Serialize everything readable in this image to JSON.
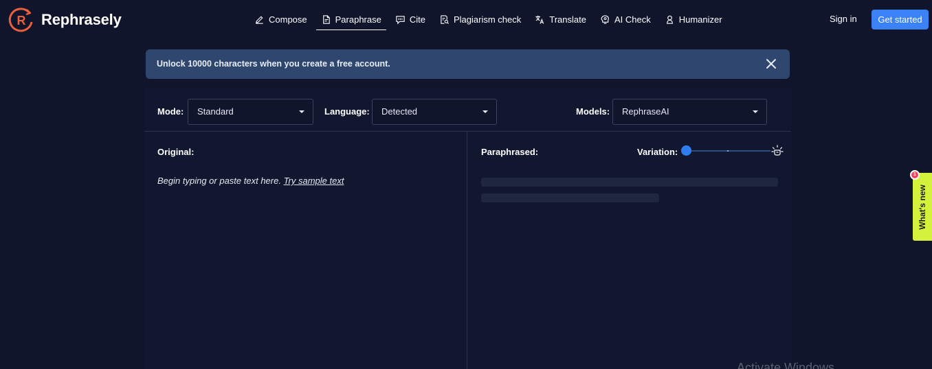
{
  "header": {
    "brand": "Rephrasely",
    "brand_color": "#e8613c",
    "nav": [
      {
        "label": "Compose",
        "icon": "pencil-icon"
      },
      {
        "label": "Paraphrase",
        "icon": "document-icon",
        "active": true
      },
      {
        "label": "Cite",
        "icon": "quote-icon"
      },
      {
        "label": "Plagiarism check",
        "icon": "document-search-icon"
      },
      {
        "label": "Translate",
        "icon": "translate-icon"
      },
      {
        "label": "AI Check",
        "icon": "brain-icon"
      },
      {
        "label": "Humanizer",
        "icon": "person-icon"
      }
    ],
    "signin_label": "Sign in",
    "cta_label": "Get started",
    "cta_color": "#3b82f6"
  },
  "banner": {
    "text": "Unlock 10000 characters when you create a free account."
  },
  "controls": {
    "mode_label": "Mode:",
    "mode_value": "Standard",
    "language_label": "Language:",
    "language_value": "Detected",
    "models_label": "Models:",
    "models_value": "RephraseAI"
  },
  "original": {
    "label": "Original:",
    "placeholder": "Begin typing or paste text here.",
    "sample_link": "Try sample text"
  },
  "paraphrased": {
    "label": "Paraphrased:",
    "variation_label": "Variation:",
    "variation_level": 0
  },
  "whats_new": {
    "label": "What's new",
    "badge": "1"
  },
  "watermark": "Activate Windows"
}
